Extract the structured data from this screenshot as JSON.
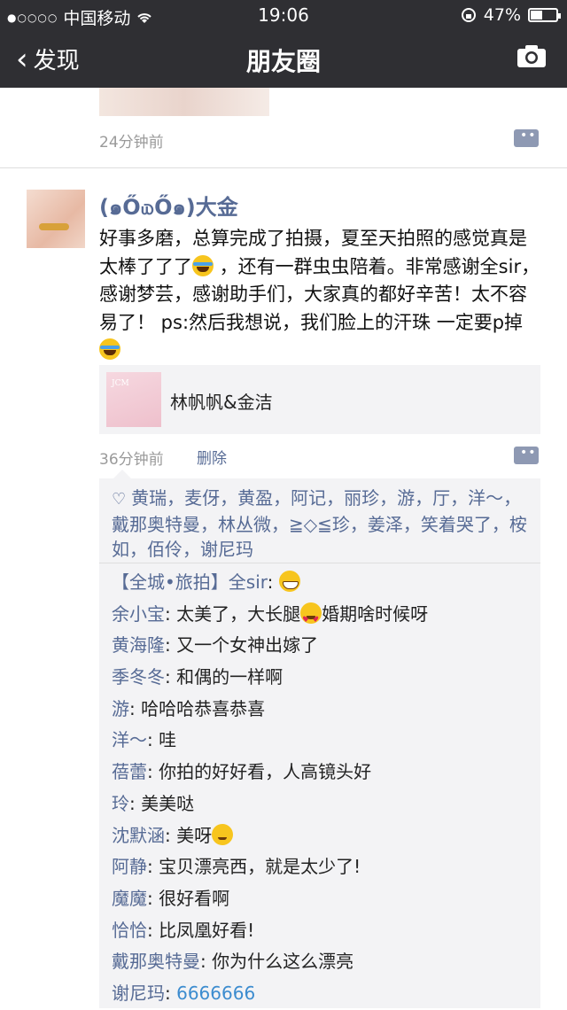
{
  "status_bar": {
    "carrier": "中国移动",
    "time": "19:06",
    "battery": "47%",
    "battery_level": 0.47
  },
  "nav": {
    "back_label": "发现",
    "title": "朋友圈"
  },
  "previous_post": {
    "time": "24分钟前"
  },
  "post": {
    "author": "(๑Ő௰Ő๑)大金",
    "text_parts": [
      "好事多磨，总算完成了拍摄，夏至天拍照的感觉真是太棒了了了",
      " ，还有一群虫虫陪着。非常感谢全sir，感谢梦芸，感谢助手们，大家真的都好辛苦！太不容易了！ ps:然后我想说，我们脸上的汗珠 一定要p掉"
    ],
    "link": {
      "title": "林帆帆&金洁",
      "thumb_text": "JCM"
    },
    "time": "36分钟前",
    "delete_label": "删除",
    "likes": "黄瑞，麦伢，黄盈，阿记，丽珍，游，厅，洋～，戴那奥特曼，林丛微，≧◇≦珍，姜泽，笑着哭了，桉如，佰伶，谢尼玛",
    "comments": [
      {
        "name": "【全城•旅拍】全sir",
        "text": "",
        "emoji": "grin"
      },
      {
        "name": "余小宝",
        "text": "太美了，大长腿",
        "emoji": "love",
        "text_after": "婚期啥时候呀"
      },
      {
        "name": "黄海隆",
        "text": "又一个女神出嫁了"
      },
      {
        "name": "季冬冬",
        "text": "和偶的一样啊"
      },
      {
        "name": "游",
        "text": "哈哈哈恭喜恭喜"
      },
      {
        "name": "洋～",
        "text": "哇"
      },
      {
        "name": "蓓蕾",
        "text": "你拍的好好看，人高镜头好"
      },
      {
        "name": "玲",
        "text": "美美哒"
      },
      {
        "name": "沈默涵",
        "text": "美呀",
        "emoji": "wink"
      },
      {
        "name": "阿静",
        "text": "宝贝漂亮西，就是太少了!"
      },
      {
        "name": "魔魔",
        "text": "很好看啊"
      },
      {
        "name": "恰恰",
        "text": "比凤凰好看!"
      },
      {
        "name": "戴那奥特曼",
        "text": "你为什么这么漂亮"
      },
      {
        "name": "谢尼玛",
        "text": "6666666",
        "link_style": true
      }
    ]
  },
  "colors": {
    "nav_bg": "#2f2f33",
    "name_blue": "#576b95",
    "panel_bg": "#f3f3f5"
  }
}
